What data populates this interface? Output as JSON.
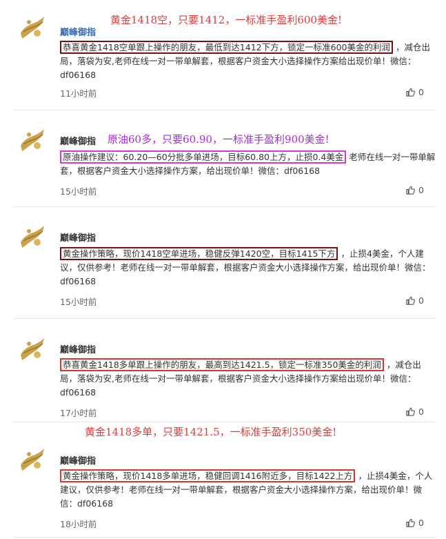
{
  "posts": [
    {
      "username": "巅峰御指",
      "banner": "黄金1418空，只要1412，一标准手盈利600美金!",
      "highlight": "恭喜黄金1418空单跟上操作的朋友，最低到达1412下方，锁定一标准600美金的利润",
      "text": "，减仓出局，落袋为安,老师在线一对一带单解套，根据客户资金大小选择操作方案给出现价单！微信：df06168",
      "time": "11小时前",
      "likes": "0"
    },
    {
      "username": "巅峰御指",
      "banner": "原油60多，只要60.90，一标准手盈利900美金!",
      "highlight": "原油操作建议：60.20—60分批多单进场，目标60.80上方，止损0.4美金",
      "text": "老师在线一对一带单解套，根据客户资金大小选择操作方案，给出现价单！微信：df06168",
      "time": "15小时前",
      "likes": "0"
    },
    {
      "username": "巅峰御指",
      "banner": "",
      "highlight": "黄金操作策略，现价1418空单进场，稳健反弹1420空，目标1415下方",
      "text": "，止损4美金，个人建议，仅供参考！老师在线一对一带单解套，根据客户资金大小选择操作方案，给出现价单！微信：df06168",
      "time": "15小时前",
      "likes": "0"
    },
    {
      "username": "巅峰御指",
      "banner": "",
      "highlight": "恭喜黄金1418多单跟上操作的朋友，最高到达1421.5，锁定一标准350美金的利润",
      "text": "，减仓出局，落袋为安,老师在线一对一带单解套，根据客户资金大小选择操作方案给出现价单！微信：df06168",
      "time": "17小时前",
      "likes": "0"
    },
    {
      "username": "巅峰御指",
      "banner": "黄金1418多单，只要1421.5，一标准手盈利350美金!",
      "highlight": "黄金操作策略，现价1418多单进场，稳健回调1416附近多，目标1422上方",
      "text": "，止损4美金，个人建议，仅供参考！老师在线一对一带单解套，根据客户资金大小选择操作方案，给出现价单！微信：df06168",
      "time": "18小时前",
      "likes": "0"
    }
  ],
  "icons": {
    "avatar": "gold-hand-logo-icon",
    "like": "thumbs-up-icon"
  },
  "colors": {
    "username_blue": "#3b6ab3",
    "banner_red": "#e03a3a",
    "banner_purple": "#a12fd0",
    "highlight_dark": "#7a0d0d",
    "highlight_magenta": "#d636d6",
    "highlight_red": "#e13232"
  }
}
